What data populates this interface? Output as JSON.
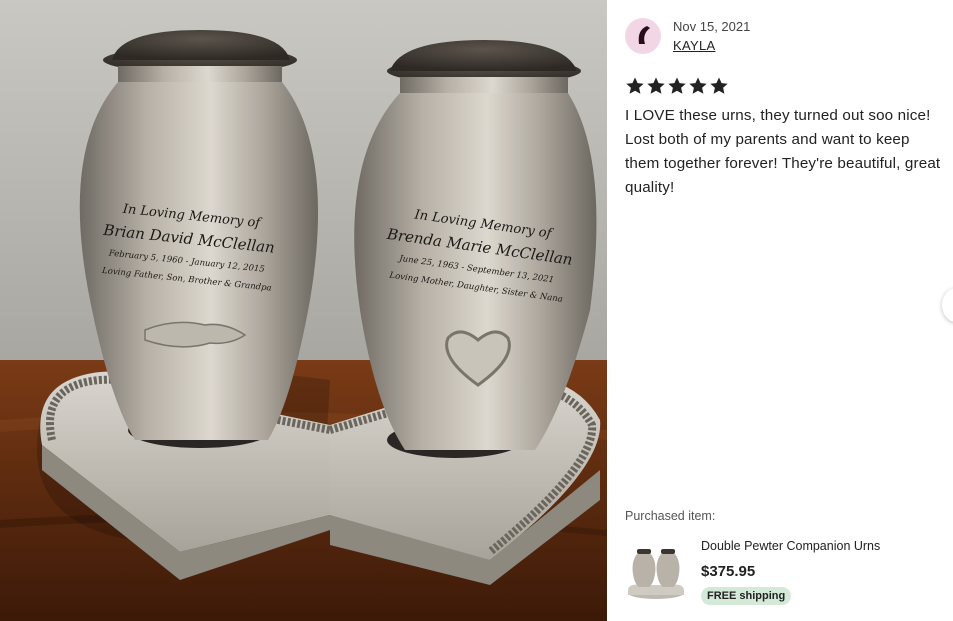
{
  "review": {
    "date": "Nov 15, 2021",
    "username": "KAYLA",
    "rating": 5,
    "text": "I LOVE these urns, they turned out soo nice! Lost both of my parents and want to keep them together forever! They're beautiful, great quality!"
  },
  "photo": {
    "urn_left": {
      "line1": "In Loving Memory of",
      "line2": "Brian David McClellan",
      "line3": "February 5, 1960 - January 12, 2015",
      "line4": "Loving Father, Son, Brother & Grandpa"
    },
    "urn_right": {
      "line1": "In Loving Memory of",
      "line2": "Brenda Marie McClellan",
      "line3": "June 25, 1963 - September 13, 2021",
      "line4": "Loving Mother, Daughter, Sister & Nana"
    }
  },
  "purchase": {
    "label": "Purchased item:",
    "title": "Double Pewter Companion Urns",
    "price": "$375.95",
    "badge": "FREE shipping"
  },
  "colors": {
    "star": "#222222",
    "badge_bg": "#d4e9d7",
    "avatar_bg": "#f3d6e6"
  },
  "icons": {
    "star": "star-icon",
    "next": "chevron-right-icon"
  }
}
